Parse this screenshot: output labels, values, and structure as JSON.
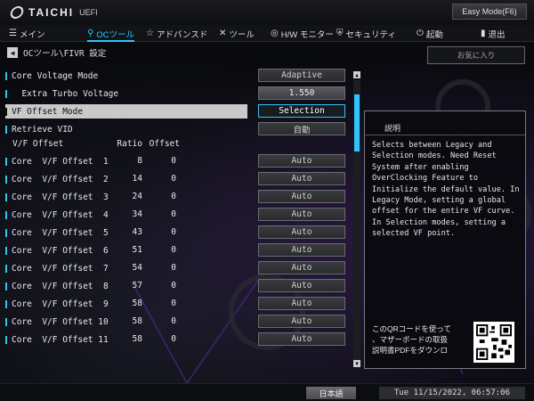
{
  "header": {
    "logo_text": "TAICHI",
    "logo_sub": "UEFI",
    "easy_mode": "Easy Mode(F6)"
  },
  "nav": {
    "main": "メイン",
    "oc": "OCツール",
    "advanced": "アドバンスド",
    "tool": "ツール",
    "hw": "H/W モニター",
    "security": "セキュリティ",
    "boot": "起動",
    "exit": "退出"
  },
  "breadcrumb": "OCツール\\FIVR 設定",
  "favorites": "お気に入り",
  "settings": [
    {
      "label": "Core Voltage Mode",
      "value": "Adaptive"
    },
    {
      "label": "  Extra Turbo Voltage",
      "value": "1.550"
    },
    {
      "label": "VF Offset Mode",
      "value": "Selection"
    },
    {
      "label": "Retrieve VID",
      "value": "自動"
    }
  ],
  "table": {
    "headers": {
      "name": "V/F Offset",
      "ratio": "Ratio",
      "offset": "Offset"
    },
    "rows": [
      {
        "label": "Core  V/F Offset  1",
        "ratio": "8",
        "offset": "0",
        "value": "Auto"
      },
      {
        "label": "Core  V/F Offset  2",
        "ratio": "14",
        "offset": "0",
        "value": "Auto"
      },
      {
        "label": "Core  V/F Offset  3",
        "ratio": "24",
        "offset": "0",
        "value": "Auto"
      },
      {
        "label": "Core  V/F Offset  4",
        "ratio": "34",
        "offset": "0",
        "value": "Auto"
      },
      {
        "label": "Core  V/F Offset  5",
        "ratio": "43",
        "offset": "0",
        "value": "Auto"
      },
      {
        "label": "Core  V/F Offset  6",
        "ratio": "51",
        "offset": "0",
        "value": "Auto"
      },
      {
        "label": "Core  V/F Offset  7",
        "ratio": "54",
        "offset": "0",
        "value": "Auto"
      },
      {
        "label": "Core  V/F Offset  8",
        "ratio": "57",
        "offset": "0",
        "value": "Auto"
      },
      {
        "label": "Core  V/F Offset  9",
        "ratio": "58",
        "offset": "0",
        "value": "Auto"
      },
      {
        "label": "Core  V/F Offset 10",
        "ratio": "58",
        "offset": "0",
        "value": "Auto"
      },
      {
        "label": "Core  V/F Offset 11",
        "ratio": "58",
        "offset": "0",
        "value": "Auto"
      }
    ]
  },
  "help": {
    "title": "説明",
    "body": "Selects between Legacy and Selection modes. Need Reset System after enabling OverClocking Feature to Initialize the default value. In Legacy Mode, setting a global offset for the entire VF curve. In Selection modes, setting a selected VF point.",
    "qr_text": "このQRコードを使って\n、マザーボードの取扱\n説明書PDFをダウンロ"
  },
  "footer": {
    "language": "日本語",
    "datetime": "Tue 11/15/2022, 06:57:06"
  },
  "colors": {
    "accent": "#2ec5ff"
  }
}
